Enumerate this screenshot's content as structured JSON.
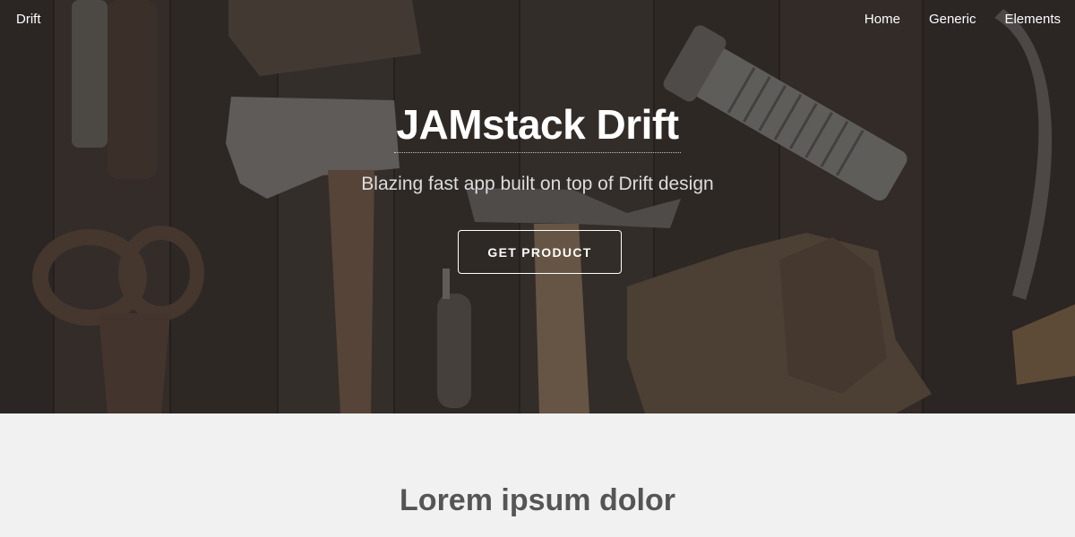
{
  "header": {
    "site_name": "Drift",
    "nav": [
      {
        "label": "Home"
      },
      {
        "label": "Generic"
      },
      {
        "label": "Elements"
      }
    ]
  },
  "hero": {
    "title": "JAMstack Drift",
    "subtitle": "Blazing fast app built on top of Drift design",
    "cta_label": "GET PRODUCT"
  },
  "section": {
    "heading": "Lorem ipsum dolor"
  },
  "colors": {
    "hero_overlay": "#2b2929",
    "section_background": "#f1f1f1",
    "heading_text": "#555555",
    "light_text": "#ffffff"
  }
}
